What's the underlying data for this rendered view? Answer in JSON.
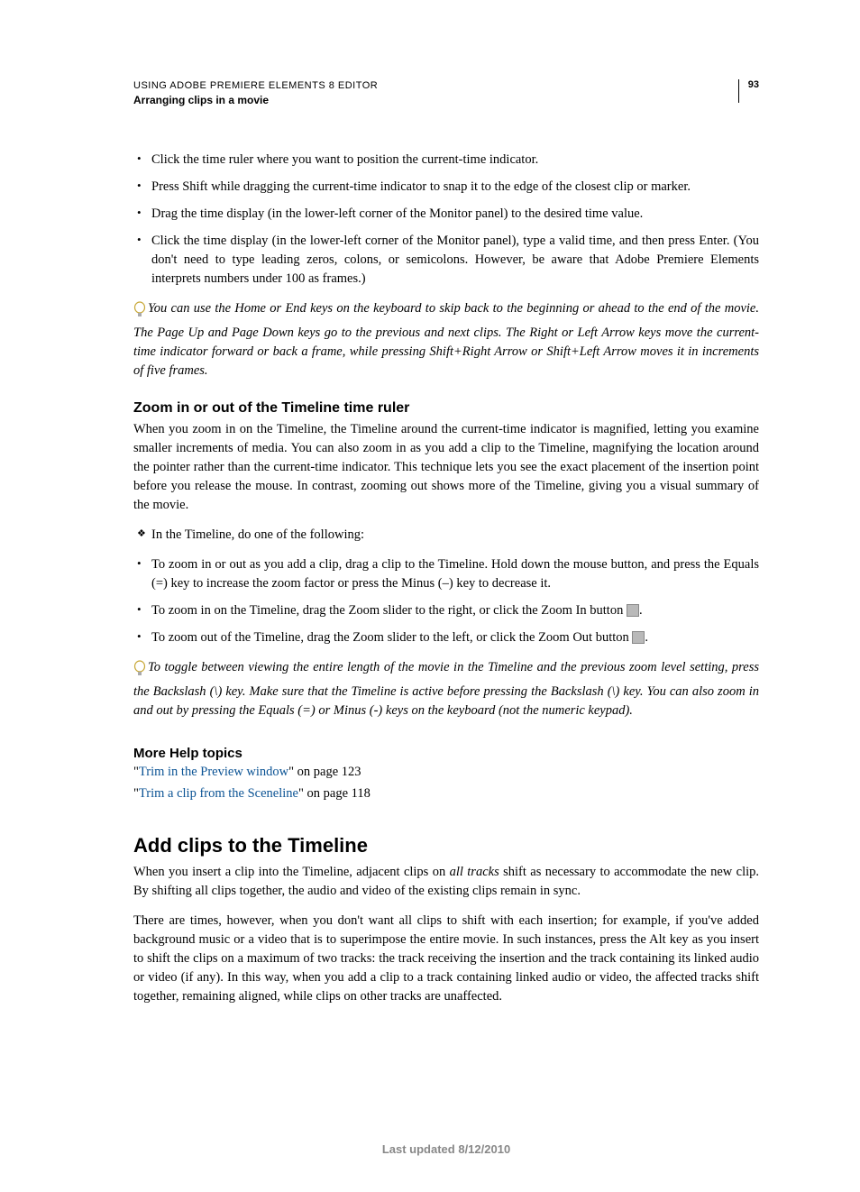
{
  "header": {
    "doc_title": "USING ADOBE PREMIERE ELEMENTS 8 EDITOR",
    "section": "Arranging clips in a movie",
    "page_number": "93"
  },
  "content": {
    "bullets_top": [
      "Click the time ruler where you want to position the current-time indicator.",
      "Press Shift while dragging the current-time indicator to snap it to the edge of the closest clip or marker.",
      "Drag the time display (in the lower-left corner of the Monitor panel) to the desired time value.",
      "Click the time display (in the lower-left corner of the Monitor panel), type a valid time, and then press Enter. (You don't need to type leading zeros, colons, or semicolons. However, be aware that Adobe Premiere Elements interprets numbers under 100 as frames.)"
    ],
    "tip1": "You can use the Home or End keys on the keyboard to skip back to the beginning or ahead to the end of the movie. The Page Up and Page Down keys go to the previous and next clips. The Right or Left Arrow keys move the current-time indicator forward or back a frame, while pressing Shift+Right Arrow or Shift+Left Arrow moves it in increments of five frames.",
    "zoom_heading": "Zoom in or out of the Timeline time ruler",
    "zoom_para": "When you zoom in on the Timeline, the Timeline around the current-time indicator is magnified, letting you examine smaller increments of media. You can also zoom in as you add a clip to the Timeline, magnifying the location around the pointer rather than the current-time indicator. This technique lets you see the exact placement of the insertion point before you release the mouse. In contrast, zooming out shows more of the Timeline, giving you a visual summary of the movie.",
    "zoom_diamond": "In the Timeline, do one of the following:",
    "zoom_bullets": [
      "To zoom in or out as you add a clip, drag a clip to the Timeline. Hold down the mouse button, and press the Equals (=) key to increase the zoom factor or press the Minus (–) key to decrease it.",
      "To zoom in on the Timeline, drag the Zoom slider to the right, or click the Zoom In button ",
      "To zoom out of the Timeline, drag the Zoom slider to the left, or click the Zoom Out button "
    ],
    "tip2": "To toggle between viewing the entire length of the movie in the Timeline and the previous zoom level setting, press the Backslash (\\) key. Make sure that the Timeline is active before pressing the Backslash (\\) key. You can also zoom in and out by pressing the Equals (=) or Minus (-) keys on the keyboard (not the numeric keypad).",
    "more_help": "More Help topics",
    "links": [
      {
        "text": "Trim in the Preview window",
        "suffix": "\" on page 123"
      },
      {
        "text": "Trim a clip from the Sceneline",
        "suffix": "\" on page 118"
      }
    ],
    "add_heading": "Add clips to the Timeline",
    "add_para1_pre": "When you insert a clip into the Timeline, adjacent clips on ",
    "add_para1_em": "all tracks",
    "add_para1_post": " shift as necessary to accommodate the new clip. By shifting all clips together, the audio and video of the existing clips remain in sync.",
    "add_para2": "There are times, however, when you don't want all clips to shift with each insertion; for example, if you've added background music or a video that is to superimpose the entire movie. In such instances, press the Alt key as you insert to shift the clips on a maximum of two tracks: the track receiving the insertion and the track containing its linked audio or video (if any). In this way, when you add a clip to a track containing linked audio or video, the affected tracks shift together, remaining aligned, while clips on other tracks are unaffected."
  },
  "footer": {
    "text": "Last updated 8/12/2010"
  }
}
